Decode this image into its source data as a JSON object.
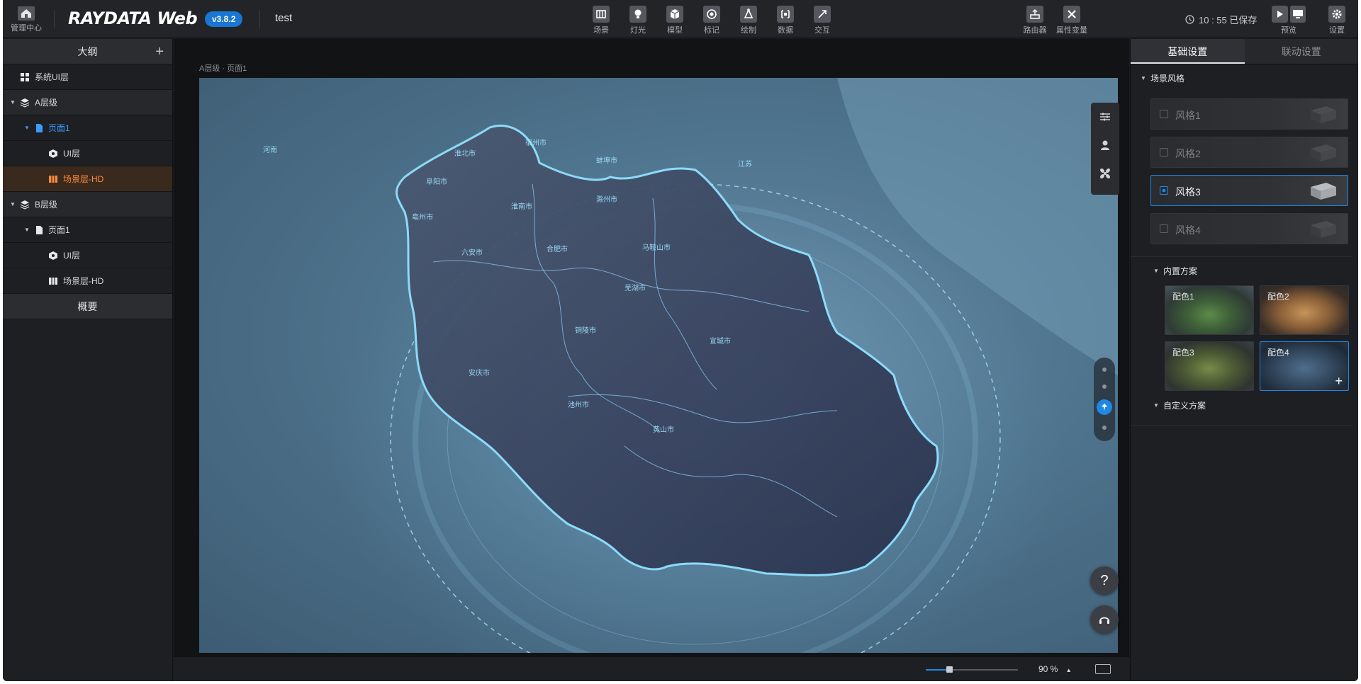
{
  "topbar": {
    "home_label": "管理中心",
    "logo": "RAYDATA Web",
    "version": "v3.8.2",
    "project": "test",
    "tools": [
      {
        "label": "场景",
        "icon": "scene-icon"
      },
      {
        "label": "灯光",
        "icon": "light-icon"
      },
      {
        "label": "模型",
        "icon": "model-icon"
      },
      {
        "label": "标记",
        "icon": "marker-icon"
      },
      {
        "label": "绘制",
        "icon": "draw-icon"
      },
      {
        "label": "数据",
        "icon": "data-icon"
      },
      {
        "label": "交互",
        "icon": "interaction-icon"
      }
    ],
    "router_label": "路由器",
    "property_var_label": "属性变量",
    "save_status": "10 : 55 已保存",
    "preview_label": "预览",
    "settings_label": "设置"
  },
  "outline": {
    "title": "大纲",
    "system_ui": "系统UI层",
    "level_a": "A层级",
    "a_page": "页面1",
    "a_ui": "UI层",
    "a_scene": "场景层-HD",
    "level_b": "B层级",
    "b_page": "页面1",
    "b_ui": "UI层",
    "b_scene": "场景层-HD",
    "summary": "概要"
  },
  "canvas": {
    "breadcrumb": "A层级 · 页面1",
    "help_label": "?",
    "map_labels": [
      {
        "text": "六安市"
      },
      {
        "text": "合肥市"
      },
      {
        "text": "马鞍山市"
      },
      {
        "text": "芜湖市"
      },
      {
        "text": "铜陵市"
      },
      {
        "text": "安庆市"
      },
      {
        "text": "池州市"
      },
      {
        "text": "宣城市"
      },
      {
        "text": "黄山市"
      },
      {
        "text": "滁州市"
      },
      {
        "text": "淮南市"
      },
      {
        "text": "阜阳市"
      },
      {
        "text": "蚌埠市"
      },
      {
        "text": "宿州市"
      },
      {
        "text": "淮北市"
      },
      {
        "text": "亳州市"
      },
      {
        "text": "江苏"
      },
      {
        "text": "河南"
      }
    ]
  },
  "bottombar": {
    "zoom_value": "90 %",
    "zoom_arrow": "▲",
    "zoom_percent": 90
  },
  "rightpanel": {
    "tab_basic": "基础设置",
    "tab_linkage": "联动设置",
    "scene_style_title": "场景风格",
    "styles": [
      "风格1",
      "风格2",
      "风格3",
      "风格4"
    ],
    "selected_style": "风格3",
    "builtin_title": "内置方案",
    "schemes": [
      "配色1",
      "配色2",
      "配色3",
      "配色4"
    ],
    "selected_scheme": "配色4",
    "custom_title": "自定义方案"
  },
  "colors": {
    "accent": "#1e88e5",
    "active_layer": "#ff8a3d",
    "background": "#1a1b1e"
  }
}
